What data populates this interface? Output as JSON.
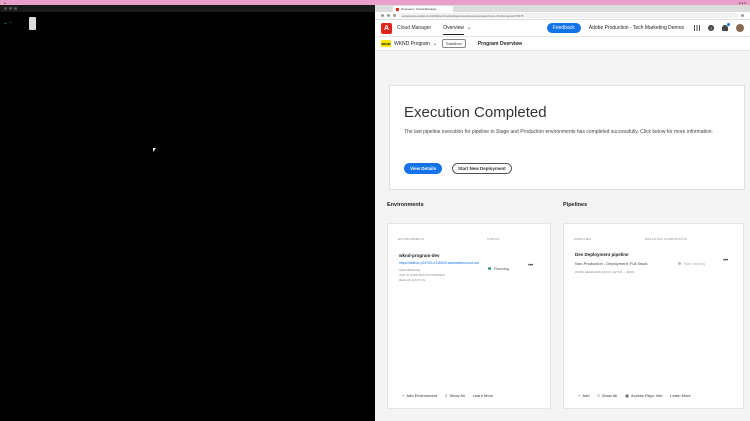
{
  "terminal": {
    "prompt_dir": "~"
  },
  "browser": {
    "tab_title": "Overview | Cloud Manager",
    "url": "experience.adobe.com/#/@techmarketingdemos/cloud-manager/home.html/program/72976"
  },
  "header": {
    "logo": "A",
    "app_name": "Cloud Manager",
    "nav_overview": "Overview",
    "feedback": "Feedback",
    "org": "Adobe Production - Tech Marketing Demos",
    "help_glyph": "?"
  },
  "program": {
    "logo": "WKND",
    "name": "WKND Program",
    "sandbox": "Sandbox",
    "overview": "Program Overview"
  },
  "execution": {
    "title": "Execution Completed",
    "description": "The last pipeline execution for pipeline to Stage and Production environments has completed successfully. Click below for more information.",
    "view_details": "View Details",
    "start_new": "Start New Deployment"
  },
  "environments": {
    "section": "Environments",
    "col_env": "ENVIRONMENTS",
    "col_status": "STATUS",
    "item": {
      "name": "wknd-program-dev",
      "link": "https://author-p24700-e116005.adobeaemcloud.com",
      "release": "AEM RELEASE:",
      "version": "2021.11.6158.20211027T185822Z",
      "region": "REGION: EAST US",
      "status": "Running"
    },
    "add": "Add Environment",
    "show_all": "Show All",
    "learn_more": "Learn More"
  },
  "pipelines": {
    "section": "Pipelines",
    "col_pipeline": "PIPELINES",
    "col_code": "DEPLOYED CODE/STATUS",
    "item": {
      "name": "Dev Deployment pipeline",
      "type": "Non-Production - Deployment: Full Stack",
      "repo": "WKND HEADLESS QUICK SETUP — MAIN",
      "status": "Not running"
    },
    "add": "Add",
    "show_all": "Show All",
    "repo_info": "Access Repo Info",
    "learn_more": "Learn More"
  },
  "colors": {
    "accent": "#1473e6",
    "adobe_red": "#e1251b",
    "running": "#2d9d78"
  }
}
